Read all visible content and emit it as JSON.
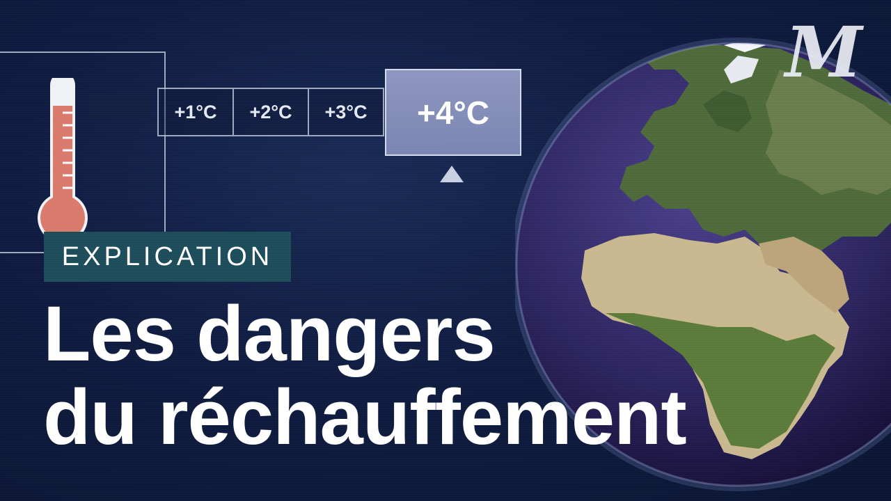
{
  "scale": {
    "steps": [
      "+1°C",
      "+2°C",
      "+3°C"
    ],
    "selected": "+4°C"
  },
  "category_tag": "EXPLICATION",
  "headline": {
    "line1": "Les dangers",
    "line2": "du réchauffement"
  },
  "logo_text": "M",
  "colors": {
    "background": "#0f1c40",
    "tag_background": "#1d4d5a",
    "thermometer_fill": "#d97a6c",
    "highlight_cell": "#8c96bf"
  },
  "icons": [
    "thermometer-icon",
    "triangle-up-icon",
    "globe-image",
    "le-monde-logo"
  ]
}
